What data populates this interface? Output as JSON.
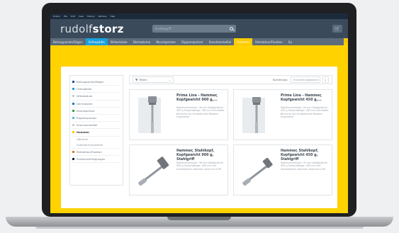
{
  "menubar": {
    "items": [
      "Firefox",
      "File",
      "Edit",
      "View",
      "History",
      "Window",
      "Help"
    ]
  },
  "header": {
    "logo_main": "rudolf",
    "logo_bold": "storz",
    "search_placeholder": "Suchbegriff",
    "cart_icon": "cart-icon"
  },
  "nav": {
    "items": [
      {
        "label": "Beinapparate/Sägen"
      },
      {
        "label": "Orthopädie"
      },
      {
        "label": "Wirbelsäule"
      },
      {
        "label": "Dermatome"
      },
      {
        "label": "Wundspreizer"
      },
      {
        "label": "Rippenspreizer"
      },
      {
        "label": "Knochenmeißel"
      },
      {
        "label": "Hammer"
      },
      {
        "label": "Retraktion/Fixation"
      },
      {
        "label": "Sa"
      }
    ],
    "arrow": "›"
  },
  "sidebar": {
    "items": [
      {
        "label": "Beinapparate/Sägen",
        "color": "#1e4fa0"
      },
      {
        "label": "Orthopädie",
        "color": "#19a1de"
      },
      {
        "label": "Wirbelsäule",
        "color": "#c9ced3"
      },
      {
        "label": "Dermatome",
        "color": "#1a7abf"
      },
      {
        "label": "Wundspreizer",
        "color": "#3aa04a"
      },
      {
        "label": "Rippenspreizer",
        "color": "#5bb8e6"
      },
      {
        "label": "Knochenmeißel",
        "color": "#c9ced3"
      },
      {
        "label": "Hammer",
        "color": "#ffcc00"
      },
      {
        "label": "Hämmer"
      },
      {
        "label": "Zubehör/Ersatzteile"
      },
      {
        "label": "Retraktion/Fixation",
        "color": "#e07820"
      },
      {
        "label": "Sonderanfertigungen",
        "color": "#1b2a3a"
      }
    ]
  },
  "toolbar": {
    "filter_label": "Filtern",
    "sort_label": "Sortierung:",
    "sort_value": "Erscheinungsdatum",
    "sort_toggle": "↓"
  },
  "products": [
    {
      "title": "Prime Line - Hammer, Kopfgewicht 900 g,...",
      "desc": "Kopfdurchmesser: 36 mm Kopfgewicht: 900 g Gesamtlänge: 285 mm Ermüdete Bereiche auf Schweißnaht Bessere Ergonomie"
    },
    {
      "title": "Prime Line - Hammer, Kopfgewicht 450 g,...",
      "desc": "Kopfdurchmesser: 28 mm Kopfgewicht: 450 g Gesamtlänge: 285 mm Ermüdete Bereiche auf Schweißnaht Bessere Ergonomie"
    },
    {
      "title": "Hammer, Stahlkopf, Kopfgewicht 900 g, Stahlgriff",
      "desc": "Kopfdurchmesser: 36 mm Kopfgewicht: 900 g Gesamtlänge: 280 mm mit Schweißnaht zwischen Kopf und Griff"
    },
    {
      "title": "Hammer, Stahlkopf, Kopfgewicht 450 g, Stahlgriff",
      "desc": "Kopfdurchmesser: 35 mm Kopfgewicht: 450 g Gesamtlänge: 280 mm mit Schweißnaht zwischen Kopf und Griff"
    }
  ],
  "colors": {
    "accent_yellow": "#ffd200",
    "accent_blue": "#19a1de",
    "header": "#3a4a5a"
  }
}
